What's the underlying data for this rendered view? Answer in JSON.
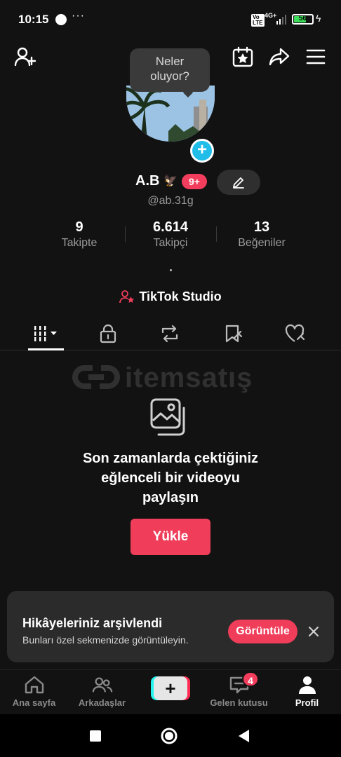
{
  "status_bar": {
    "time": "10:15",
    "more": "···",
    "volte": "Vo LTE",
    "network": "4G+",
    "battery": "56"
  },
  "top_bar": {
    "icons": [
      "add-friend-icon",
      "calendar-star-icon",
      "share-icon",
      "menu-icon"
    ]
  },
  "tooltip": {
    "line1": "Neler",
    "line2": "oluyor?"
  },
  "profile": {
    "name": "A.B",
    "name_emoji": "🦅",
    "badge": "9+",
    "username": "@ab.31g",
    "bio": "."
  },
  "stats": [
    {
      "value": "9",
      "label": "Takipte"
    },
    {
      "value": "6.614",
      "label": "Takipçi"
    },
    {
      "value": "13",
      "label": "Beğeniler"
    }
  ],
  "studio": {
    "label": "TikTok Studio"
  },
  "tabs": [
    "grid-icon",
    "lock-icon",
    "repost-icon",
    "saved-icon",
    "liked-icon"
  ],
  "watermark": {
    "text": "itemsatış"
  },
  "empty_state": {
    "line1": "Son zamanlarda çektiğiniz",
    "line2": "eğlenceli bir videoyu",
    "line3": "paylaşın",
    "button": "Yükle"
  },
  "toast": {
    "title": "Hikâyeleriniz arşivlendi",
    "subtitle": "Bunları özel sekmenizde görüntüleyin.",
    "button": "Görüntüle"
  },
  "bottom_nav": {
    "home": "Ana sayfa",
    "friends": "Arkadaşlar",
    "create": "+",
    "inbox": "Gelen kutusu",
    "inbox_badge": "4",
    "profile": "Profil"
  },
  "colors": {
    "accent": "#ef3d5a",
    "background": "#121212",
    "avatar_plus": "#20bde8"
  }
}
